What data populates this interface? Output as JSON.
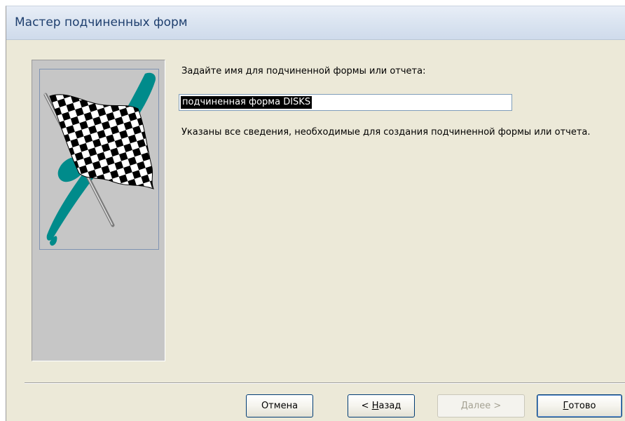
{
  "window": {
    "title": "Мастер подчиненных форм"
  },
  "main": {
    "prompt_label": "Задайте имя для подчиненной формы или отчета:",
    "name_value": "подчиненная форма DISKS",
    "info_text": "Указаны все сведения, необходимые для создания подчиненной формы или отчета."
  },
  "buttons": {
    "cancel": "Отмена",
    "back_prefix": "< ",
    "back_mnemonic": "Н",
    "back_rest": "азад",
    "next_mnemonic": "Д",
    "next_rest": "алее >",
    "finish_mnemonic": "Г",
    "finish_rest": "отово"
  },
  "icons": {
    "wizard_picture": "checkered-flag-icon"
  },
  "colors": {
    "flag_accent": "#008b8b",
    "selection": "#000000"
  }
}
